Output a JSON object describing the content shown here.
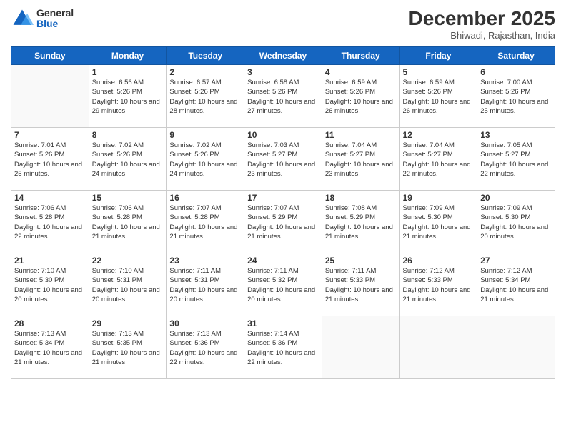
{
  "logo": {
    "general": "General",
    "blue": "Blue"
  },
  "title": "December 2025",
  "location": "Bhiwadi, Rajasthan, India",
  "days": [
    "Sunday",
    "Monday",
    "Tuesday",
    "Wednesday",
    "Thursday",
    "Friday",
    "Saturday"
  ],
  "weeks": [
    [
      {
        "num": "",
        "sunrise": "",
        "sunset": "",
        "daylight": ""
      },
      {
        "num": "1",
        "sunrise": "6:56 AM",
        "sunset": "5:26 PM",
        "daylight": "10 hours and 29 minutes."
      },
      {
        "num": "2",
        "sunrise": "6:57 AM",
        "sunset": "5:26 PM",
        "daylight": "10 hours and 28 minutes."
      },
      {
        "num": "3",
        "sunrise": "6:58 AM",
        "sunset": "5:26 PM",
        "daylight": "10 hours and 27 minutes."
      },
      {
        "num": "4",
        "sunrise": "6:59 AM",
        "sunset": "5:26 PM",
        "daylight": "10 hours and 26 minutes."
      },
      {
        "num": "5",
        "sunrise": "6:59 AM",
        "sunset": "5:26 PM",
        "daylight": "10 hours and 26 minutes."
      },
      {
        "num": "6",
        "sunrise": "7:00 AM",
        "sunset": "5:26 PM",
        "daylight": "10 hours and 25 minutes."
      }
    ],
    [
      {
        "num": "7",
        "sunrise": "7:01 AM",
        "sunset": "5:26 PM",
        "daylight": "10 hours and 25 minutes."
      },
      {
        "num": "8",
        "sunrise": "7:02 AM",
        "sunset": "5:26 PM",
        "daylight": "10 hours and 24 minutes."
      },
      {
        "num": "9",
        "sunrise": "7:02 AM",
        "sunset": "5:26 PM",
        "daylight": "10 hours and 24 minutes."
      },
      {
        "num": "10",
        "sunrise": "7:03 AM",
        "sunset": "5:27 PM",
        "daylight": "10 hours and 23 minutes."
      },
      {
        "num": "11",
        "sunrise": "7:04 AM",
        "sunset": "5:27 PM",
        "daylight": "10 hours and 23 minutes."
      },
      {
        "num": "12",
        "sunrise": "7:04 AM",
        "sunset": "5:27 PM",
        "daylight": "10 hours and 22 minutes."
      },
      {
        "num": "13",
        "sunrise": "7:05 AM",
        "sunset": "5:27 PM",
        "daylight": "10 hours and 22 minutes."
      }
    ],
    [
      {
        "num": "14",
        "sunrise": "7:06 AM",
        "sunset": "5:28 PM",
        "daylight": "10 hours and 22 minutes."
      },
      {
        "num": "15",
        "sunrise": "7:06 AM",
        "sunset": "5:28 PM",
        "daylight": "10 hours and 21 minutes."
      },
      {
        "num": "16",
        "sunrise": "7:07 AM",
        "sunset": "5:28 PM",
        "daylight": "10 hours and 21 minutes."
      },
      {
        "num": "17",
        "sunrise": "7:07 AM",
        "sunset": "5:29 PM",
        "daylight": "10 hours and 21 minutes."
      },
      {
        "num": "18",
        "sunrise": "7:08 AM",
        "sunset": "5:29 PM",
        "daylight": "10 hours and 21 minutes."
      },
      {
        "num": "19",
        "sunrise": "7:09 AM",
        "sunset": "5:30 PM",
        "daylight": "10 hours and 21 minutes."
      },
      {
        "num": "20",
        "sunrise": "7:09 AM",
        "sunset": "5:30 PM",
        "daylight": "10 hours and 20 minutes."
      }
    ],
    [
      {
        "num": "21",
        "sunrise": "7:10 AM",
        "sunset": "5:30 PM",
        "daylight": "10 hours and 20 minutes."
      },
      {
        "num": "22",
        "sunrise": "7:10 AM",
        "sunset": "5:31 PM",
        "daylight": "10 hours and 20 minutes."
      },
      {
        "num": "23",
        "sunrise": "7:11 AM",
        "sunset": "5:31 PM",
        "daylight": "10 hours and 20 minutes."
      },
      {
        "num": "24",
        "sunrise": "7:11 AM",
        "sunset": "5:32 PM",
        "daylight": "10 hours and 20 minutes."
      },
      {
        "num": "25",
        "sunrise": "7:11 AM",
        "sunset": "5:33 PM",
        "daylight": "10 hours and 21 minutes."
      },
      {
        "num": "26",
        "sunrise": "7:12 AM",
        "sunset": "5:33 PM",
        "daylight": "10 hours and 21 minutes."
      },
      {
        "num": "27",
        "sunrise": "7:12 AM",
        "sunset": "5:34 PM",
        "daylight": "10 hours and 21 minutes."
      }
    ],
    [
      {
        "num": "28",
        "sunrise": "7:13 AM",
        "sunset": "5:34 PM",
        "daylight": "10 hours and 21 minutes."
      },
      {
        "num": "29",
        "sunrise": "7:13 AM",
        "sunset": "5:35 PM",
        "daylight": "10 hours and 21 minutes."
      },
      {
        "num": "30",
        "sunrise": "7:13 AM",
        "sunset": "5:36 PM",
        "daylight": "10 hours and 22 minutes."
      },
      {
        "num": "31",
        "sunrise": "7:14 AM",
        "sunset": "5:36 PM",
        "daylight": "10 hours and 22 minutes."
      },
      {
        "num": "",
        "sunrise": "",
        "sunset": "",
        "daylight": ""
      },
      {
        "num": "",
        "sunrise": "",
        "sunset": "",
        "daylight": ""
      },
      {
        "num": "",
        "sunrise": "",
        "sunset": "",
        "daylight": ""
      }
    ]
  ]
}
